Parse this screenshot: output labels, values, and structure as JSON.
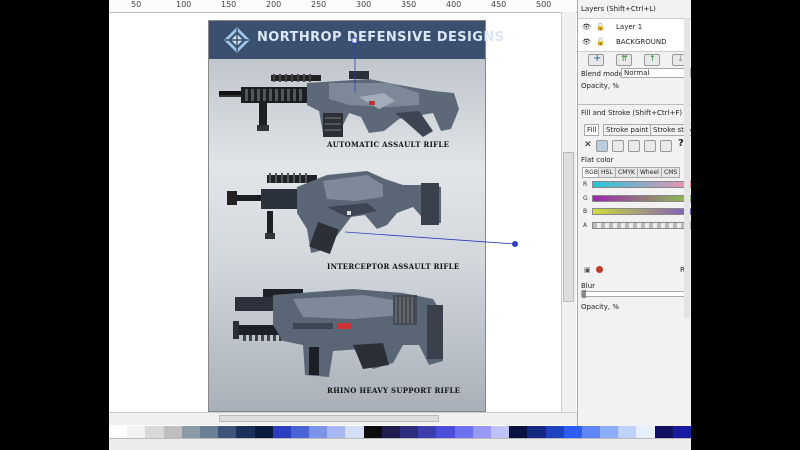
{
  "ruler": {
    "labels": [
      "50",
      "100",
      "150",
      "200",
      "250",
      "300",
      "350",
      "400",
      "450",
      "500"
    ]
  },
  "document": {
    "banner_text": "NORTHROP DEFENSIVE DESIGNS",
    "captions": [
      "AUTOMATIC ASSAULT RIFLE",
      "INTERCEPTOR ASSAULT RIFLE",
      "RHINO HEAVY SUPPORT RIFLE"
    ]
  },
  "layers": {
    "title": "Layers (Shift+Ctrl+L)",
    "items": [
      "Layer 1",
      "BACKGROUND"
    ],
    "blend_label": "Blend mode:",
    "blend_value": "Normal",
    "opacity_label": "Opacity, %"
  },
  "fill": {
    "title": "Fill and Stroke (Shift+Ctrl+F)",
    "tabs": [
      "Fill",
      "Stroke paint",
      "Stroke style"
    ],
    "flat_color": "Flat color",
    "modes": [
      "RGB",
      "HSL",
      "CMYK",
      "Wheel",
      "CMS"
    ],
    "channels": [
      "R",
      "G",
      "B",
      "A"
    ],
    "rgb_label": "RG",
    "blur_label": "Blur",
    "opacity_label": "Opacity, %"
  },
  "colors": {
    "banner": "#3b4f6e",
    "accent": "#2c3ebf"
  }
}
